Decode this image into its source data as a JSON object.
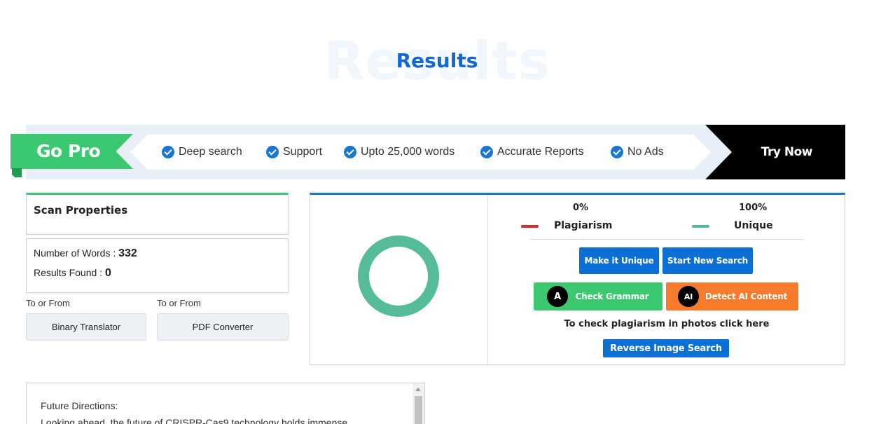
{
  "page": {
    "background_word": "Results",
    "title": "Results"
  },
  "promo": {
    "badge": "Go Pro",
    "features": [
      "Deep search",
      "Support",
      "Upto 25,000 words",
      "Accurate Reports",
      "No Ads"
    ],
    "cta": "Try Now",
    "colors": {
      "badge": "#3cc870",
      "cta_bg": "#000000",
      "check": "#1976d2"
    }
  },
  "scan_properties": {
    "title": "Scan Properties",
    "words_label": "Number of Words :",
    "words_value": "332",
    "results_label": "Results Found :",
    "results_value": "0"
  },
  "tools": [
    {
      "label": "To or From",
      "button": "Binary Translator"
    },
    {
      "label": "To or From",
      "button": "PDF Converter"
    }
  ],
  "result": {
    "plagiarism_percent": "0%",
    "plagiarism_label": "Plagiarism",
    "unique_percent": "100%",
    "unique_label": "Unique",
    "unique_fraction": 1.0,
    "colors": {
      "plagiarism": "#d32f2f",
      "unique": "#55bb99"
    },
    "buttons": {
      "make_unique": "Make it Unique",
      "new_search": "Start New Search",
      "check_grammar": "Check Grammar",
      "detect_ai": "Detect AI Content",
      "reverse_image": "Reverse Image Search"
    },
    "icons": {
      "grammar": "A",
      "ai": "AI"
    },
    "photo_text": "To check plagiarism in photos click here"
  },
  "content": {
    "lines": [
      "Future Directions:",
      "Looking ahead, the future of CRISPR-Cas9 technology holds immense"
    ]
  }
}
